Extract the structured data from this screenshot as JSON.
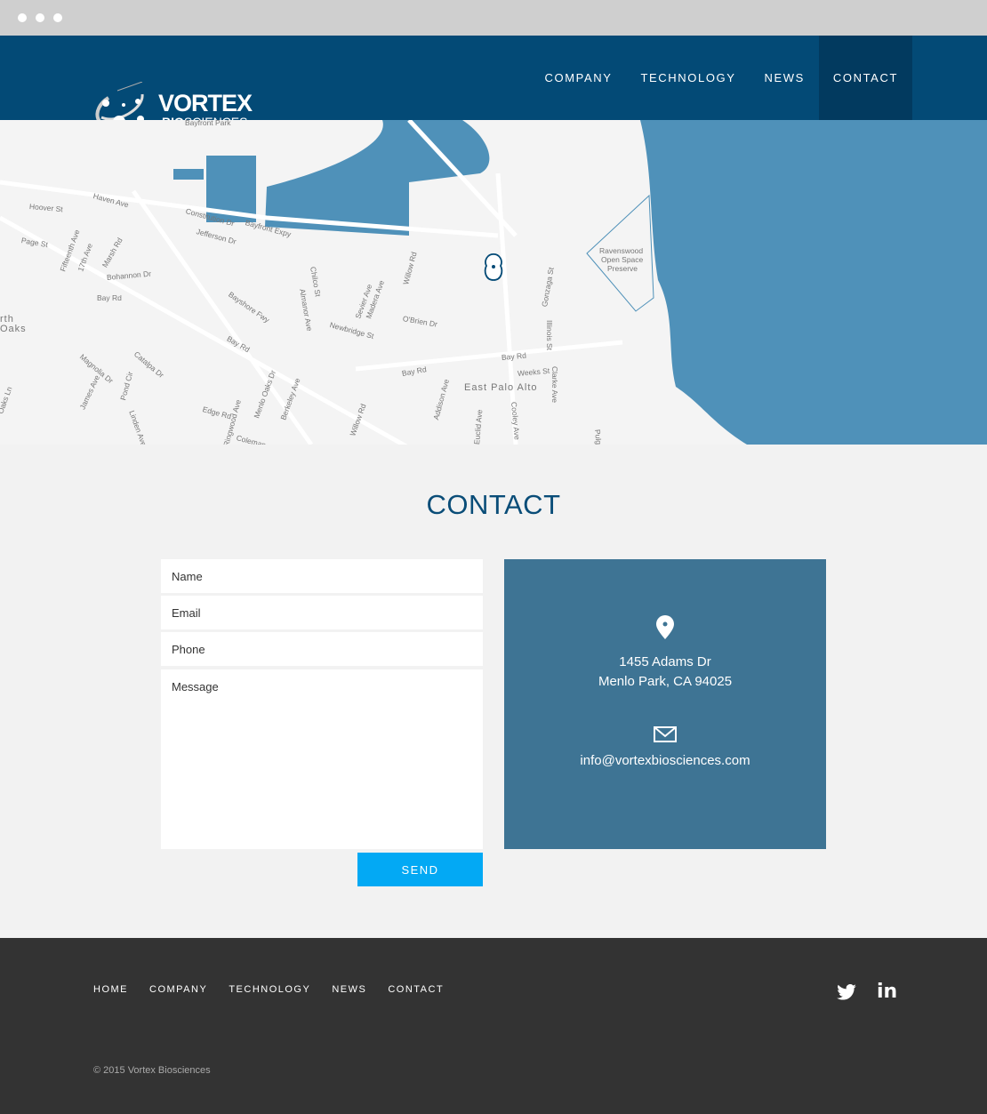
{
  "header": {
    "logo_main": "VORTEX",
    "logo_bio": "BIO",
    "logo_sub": "SCIENCES",
    "nav": [
      {
        "label": "COMPANY"
      },
      {
        "label": "TECHNOLOGY"
      },
      {
        "label": "NEWS"
      },
      {
        "label": "CONTACT",
        "active": true
      }
    ]
  },
  "map": {
    "water_color": "#4f91b9",
    "labels": [
      "Bayfront Park",
      "Haven Ave",
      "Hoover St",
      "Constitution Dr",
      "Bayfront Expy",
      "Jefferson Dr",
      "Page St",
      "Fifteenth Ave",
      "17th Ave",
      "Marsh Rd",
      "Bohannon Dr",
      "Bay Rd",
      "Bayshore Fwy",
      "Bay Rd",
      "Chilco St",
      "Almanor Ave",
      "Sevier Ave",
      "Madera Ave",
      "Willow Rd",
      "Newbridge St",
      "O'Brien Dr",
      "Gonzaga St",
      "Illinois St",
      "Ravenswood",
      "Open Space",
      "Preserve",
      "Bay Rd",
      "Weeks St",
      "East Palo Alto",
      "Clarke Ave",
      "Bay Rd",
      "Magnolia Dr",
      "Catalpa Dr",
      "James Ave",
      "Pond Cir",
      "Linden Ave",
      "Edge Rd",
      "Ringwood Ave",
      "Menlo Oaks Dr",
      "Berkeley Ave",
      "Willow Rd",
      "Addison Ave",
      "Euclid Ave",
      "Cooley Ave",
      "Coleman",
      "rth",
      "Oaks",
      "Oaks Ln",
      "Pulgas"
    ]
  },
  "contact": {
    "title": "CONTACT",
    "form": {
      "name": "Name",
      "email": "Email",
      "phone": "Phone",
      "message": "Message",
      "send": "SEND"
    },
    "address1": "1455 Adams Dr",
    "address2": "Menlo Park, CA 94025",
    "email": "info@vortexbiosciences.com"
  },
  "footer": {
    "nav": [
      "HOME",
      "COMPANY",
      "TECHNOLOGY",
      "NEWS",
      "CONTACT"
    ],
    "copyright": "© 2015 Vortex Biosciences"
  },
  "colors": {
    "header": "#034a76",
    "active": "#023a5f",
    "send": "#03a9f4",
    "info": "#3e7494",
    "footer": "#333333"
  }
}
